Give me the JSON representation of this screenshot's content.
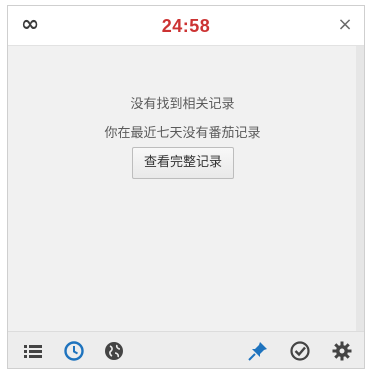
{
  "titlebar": {
    "timer": "24:58",
    "infinity_icon": "infinity-icon",
    "close_icon": "close-icon",
    "close_glyph": "×",
    "infinity_glyph": "∞",
    "timer_color": "#cc3333"
  },
  "content": {
    "message_no_records": "没有找到相关记录",
    "message_no_tomato_7_days": "你在最近七天没有番茄记录",
    "view_all_button": "查看完整记录"
  },
  "toolbar": {
    "icons": [
      "list-icon",
      "clock-icon",
      "globe-icon",
      "pin-icon",
      "check-circle-icon",
      "gear-icon"
    ],
    "active_color": "#1e73be"
  }
}
